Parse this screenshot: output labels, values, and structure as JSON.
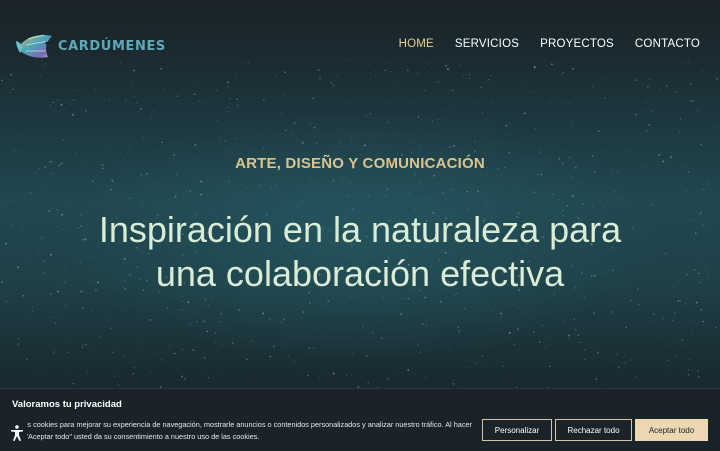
{
  "brand": {
    "name": "CARDÚMENES"
  },
  "nav": {
    "items": [
      {
        "label": "HOME",
        "active": true
      },
      {
        "label": "SERVICIOS",
        "active": false
      },
      {
        "label": "PROYECTOS",
        "active": false
      },
      {
        "label": "CONTACTO",
        "active": false
      }
    ]
  },
  "hero": {
    "eyebrow": "ARTE, DISEÑO Y COMUNICACIÓN",
    "headline_line1": "Inspiración en la naturaleza para",
    "headline_line2": "una colaboración efectiva"
  },
  "cookie": {
    "title": "Valoramos tu privacidad",
    "text": "…nos cookies para mejorar su experiencia de navegación, mostrarle anuncios o contenidos personalizados y analizar nuestro tráfico. Al hacer …n \"Aceptar todo\" usted da su consentimiento a nuestro uso de las cookies.",
    "customize_label": "Personalizar",
    "reject_label": "Rechazar todo",
    "accept_label": "Aceptar todo"
  },
  "icons": {
    "logo": "fish-logo-icon",
    "accessibility": "accessibility-icon"
  },
  "colors": {
    "accent_gold": "#dcc38e",
    "nav_active": "#e6cf9a",
    "headline": "#d8ecd6",
    "brand_teal": "#5fa9b8",
    "cookie_bg": "#1a2329",
    "accept_bg": "#ecd7b2"
  }
}
